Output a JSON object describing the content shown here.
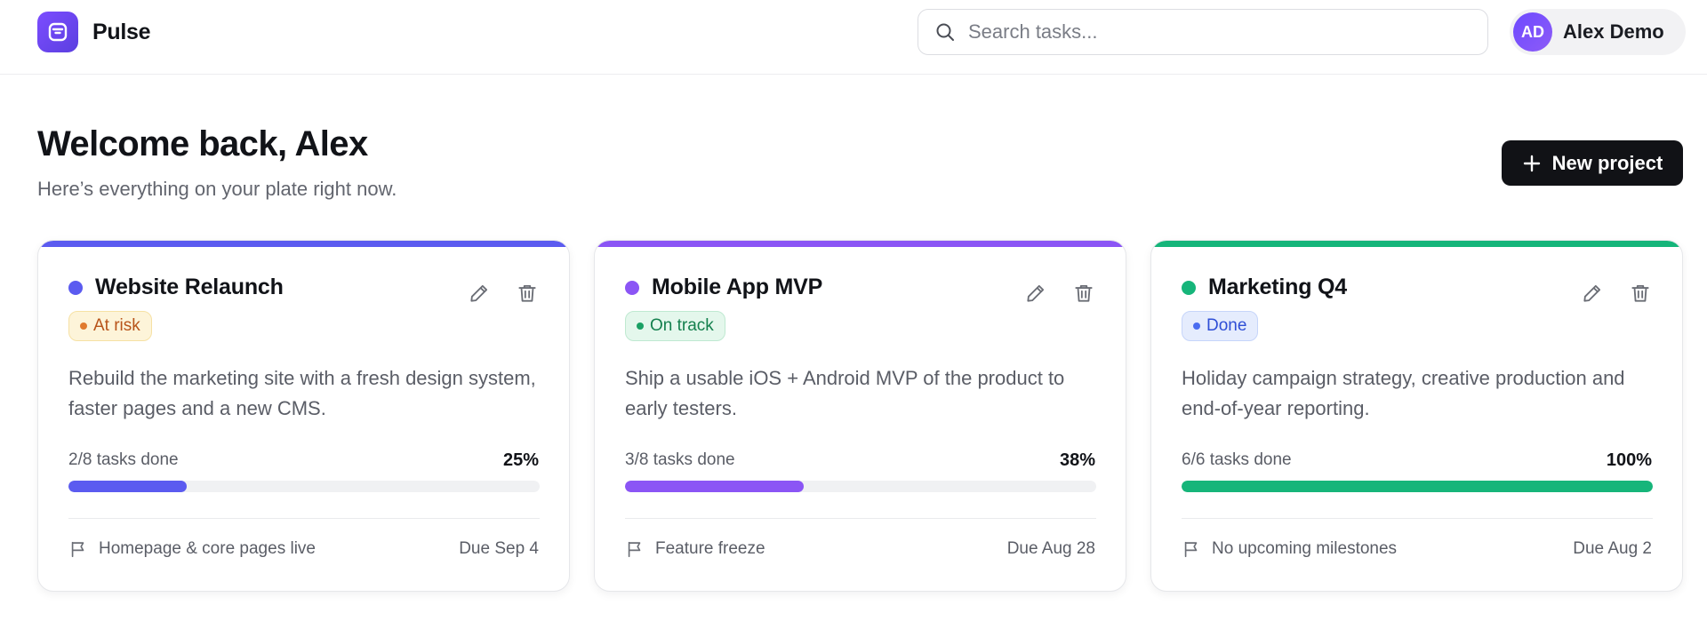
{
  "app": {
    "name": "Pulse"
  },
  "search": {
    "placeholder": "Search tasks..."
  },
  "user": {
    "initials": "AD",
    "name": "Alex Demo"
  },
  "header": {
    "title": "Welcome back, Alex",
    "subtitle": "Here’s everything on your plate right now.",
    "new_project_label": "New project"
  },
  "colors": {
    "brand": "#6b46f5",
    "indigo": "#5b5bf0",
    "purple": "#8b55f5",
    "green": "#16b57a"
  },
  "projects": [
    {
      "name": "Website Relaunch",
      "accent": "#5b5bf0",
      "status": {
        "label": "At risk",
        "bg": "#fdf4d9",
        "border": "#f6e1a4",
        "text": "#b8541a",
        "dot": "#e07a2e"
      },
      "description": "Rebuild the marketing site with a fresh design system, faster pages and a new CMS.",
      "tasks_label": "2/8 tasks done",
      "percent_label": "25%",
      "progress": 0.25,
      "milestone": "Homepage & core pages live",
      "due": "Due Sep 4"
    },
    {
      "name": "Mobile App MVP",
      "accent": "#8b55f5",
      "status": {
        "label": "On track",
        "bg": "#e4f7ec",
        "border": "#bfe9d1",
        "text": "#14804e",
        "dot": "#1aa064"
      },
      "description": "Ship a usable iOS + Android MVP of the product to early testers.",
      "tasks_label": "3/8 tasks done",
      "percent_label": "38%",
      "progress": 0.38,
      "milestone": "Feature freeze",
      "due": "Due Aug 28"
    },
    {
      "name": "Marketing Q4",
      "accent": "#16b57a",
      "status": {
        "label": "Done",
        "bg": "#e5ecfd",
        "border": "#c6d5fa",
        "text": "#2f4fd6",
        "dot": "#4a6cf0"
      },
      "description": "Holiday campaign strategy, creative production and end-of-year reporting.",
      "tasks_label": "6/6 tasks done",
      "percent_label": "100%",
      "progress": 1.0,
      "milestone": "No upcoming milestones",
      "due": "Due Aug 2"
    }
  ],
  "icons": {
    "logo": "pulse-logo-icon",
    "search": "search-icon",
    "plus": "plus-icon",
    "edit": "pencil-icon",
    "delete": "trash-icon",
    "milestone": "flag-icon"
  }
}
